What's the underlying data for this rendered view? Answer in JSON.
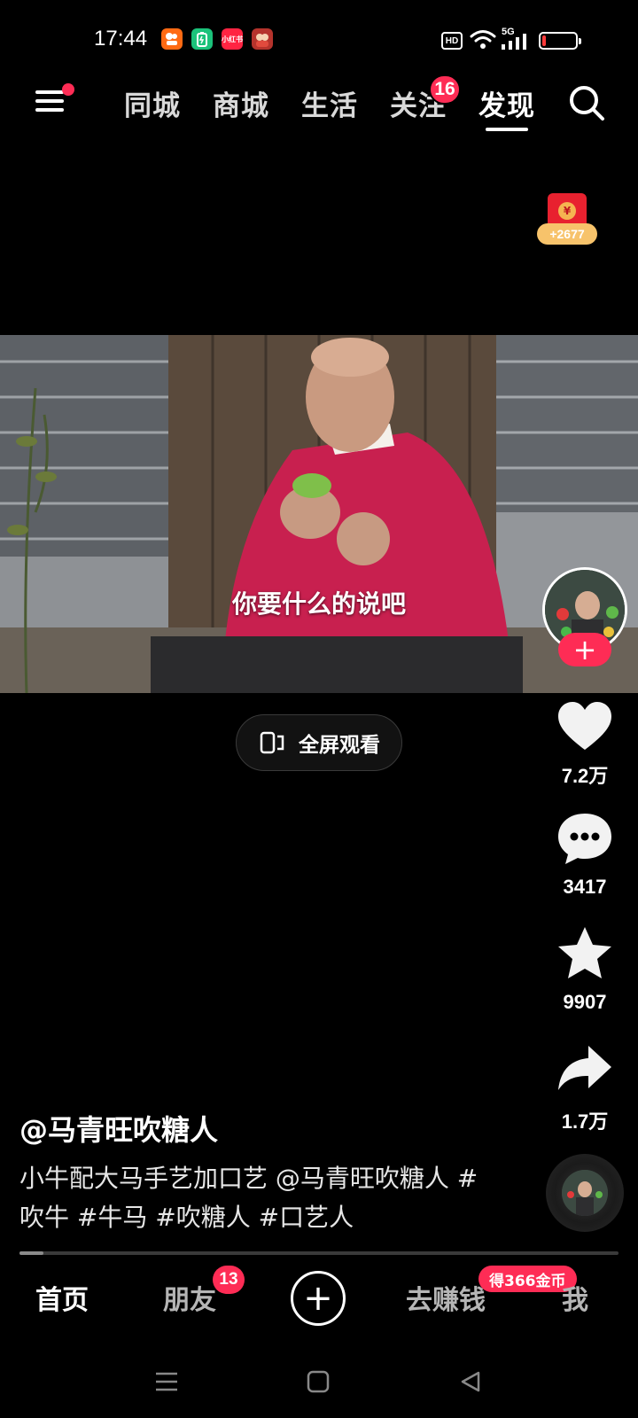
{
  "status_bar": {
    "time": "17:44",
    "app_icons": [
      "kuaishou-icon",
      "battery-app-icon",
      "xiaohongshu-icon",
      "avatar-app-icon"
    ],
    "xiaohongshu_label": "小红书",
    "hd_label": "HD",
    "network_label": "5G",
    "battery_level": 0.12,
    "battery_color": "#ff3b3b"
  },
  "top_nav": {
    "tabs": [
      {
        "label": "同城",
        "active": false
      },
      {
        "label": "商城",
        "active": false
      },
      {
        "label": "生活",
        "active": false
      },
      {
        "label": "关注",
        "active": false
      },
      {
        "label": "发现",
        "active": true
      }
    ],
    "follow_badge": "16"
  },
  "red_packet": {
    "coin_symbol": "¥",
    "amount": "+2677"
  },
  "video": {
    "subtitle": "你要什么的说吧"
  },
  "fullscreen": {
    "label": "全屏观看"
  },
  "actions": {
    "follow_plus": "+",
    "likes": "7.2万",
    "comments": "3417",
    "favorites": "9907",
    "shares": "1.7万"
  },
  "caption": {
    "author": "@马青旺吹糖人",
    "description": "小牛配大马手艺加口艺 @马青旺吹糖人 #吹牛 #牛马 #吹糖人 #口艺人",
    "progress": 0.04
  },
  "bottom_tabs": {
    "home": "首页",
    "friends": "朋友",
    "friends_badge": "13",
    "add": "+",
    "earn": "去赚钱",
    "earn_badge": "得366金币",
    "me": "我"
  },
  "colors": {
    "accent": "#fe2c55",
    "background": "#000000"
  }
}
